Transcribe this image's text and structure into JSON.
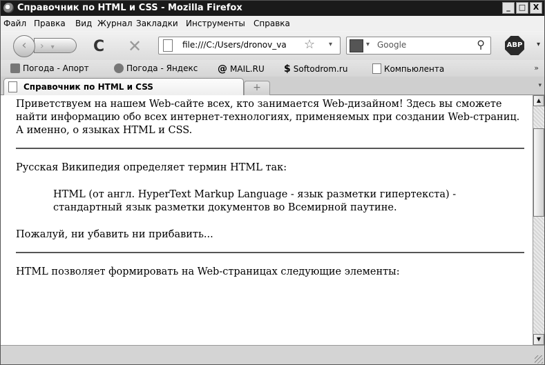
{
  "window": {
    "title": "Справочник по HTML и CSS - Mozilla Firefox",
    "controls": {
      "minimize": "_",
      "maximize": "□",
      "close": "X"
    }
  },
  "menu": {
    "items": [
      "Файл",
      "Правка",
      "Вид",
      "Журнал",
      "Закладки",
      "Инструменты",
      "Справка"
    ]
  },
  "navbar": {
    "url": "file:///C:/Users/dronov_va",
    "search_placeholder": "Google",
    "adblock_label": "ABP"
  },
  "bookmarks": {
    "items": [
      "Погода - Апорт",
      "Погода - Яндекс",
      "MAIL.RU",
      "Softodrom.ru",
      "Компьюлента"
    ],
    "more": "»"
  },
  "tabs": {
    "items": [
      {
        "label": "Справочник по HTML и CSS"
      }
    ],
    "new_tab": "+"
  },
  "content": {
    "p1": "Приветствуем на нашем Web-сайте всех, кто занимается Web-дизайном! Здесь вы сможете найти информацию обо всех интернет-технологиях, применяемых при создании Web-страниц. А именно, о языках HTML и CSS.",
    "p2": "Русская Википедия определяет термин HTML так:",
    "quote": "HTML (от англ. HyperText Markup Language - язык разметки гипертекста) - стандартный язык разметки документов во Всемирной паутине.",
    "p3": "Пожалуй, ни убавить ни прибавить...",
    "p4": "HTML позволяет формировать на Web-страницах следующие элементы:"
  },
  "colors": {
    "titlebar": "#1a1a1a",
    "content_bg": "#ffffff",
    "chrome": "#d8d8d8"
  }
}
